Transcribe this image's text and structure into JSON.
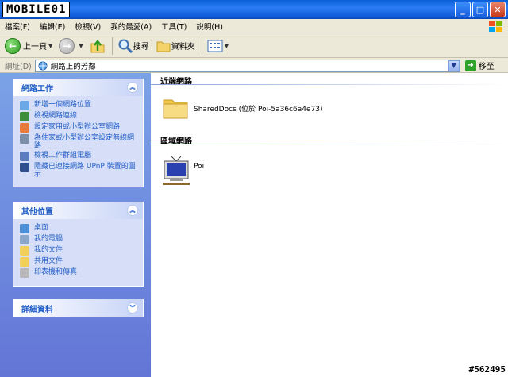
{
  "titlebar": {
    "watermark": "MOBILE01"
  },
  "menu": [
    "檔案(F)",
    "編輯(E)",
    "檢視(V)",
    "我的最愛(A)",
    "工具(T)",
    "說明(H)"
  ],
  "toolbar": {
    "back": "上一頁",
    "search": "搜尋",
    "folders": "資料夾"
  },
  "address": {
    "label": "網址(D)",
    "value": "網路上的芳鄰",
    "go": "移至"
  },
  "tasks": {
    "network": {
      "title": "網路工作",
      "items": [
        "新增一個網路位置",
        "檢視網路連線",
        "設定家用或小型辦公室網路",
        "為住家或小型辦公室設定無線網路",
        "檢視工作群組電腦",
        "隱藏已連接網路 UPnP 裝置的圖示"
      ]
    },
    "other": {
      "title": "其他位置",
      "items": [
        "桌面",
        "我的電腦",
        "我的文件",
        "共用文件",
        "印表機和傳真"
      ]
    },
    "details": {
      "title": "詳細資料"
    }
  },
  "content": {
    "nearby_header": "近端網路",
    "shared_item": "SharedDocs (位於 Poi-5a36c6a4e73)",
    "local_header": "區域網路",
    "local_item": "Poi"
  },
  "stamp": "#562495"
}
